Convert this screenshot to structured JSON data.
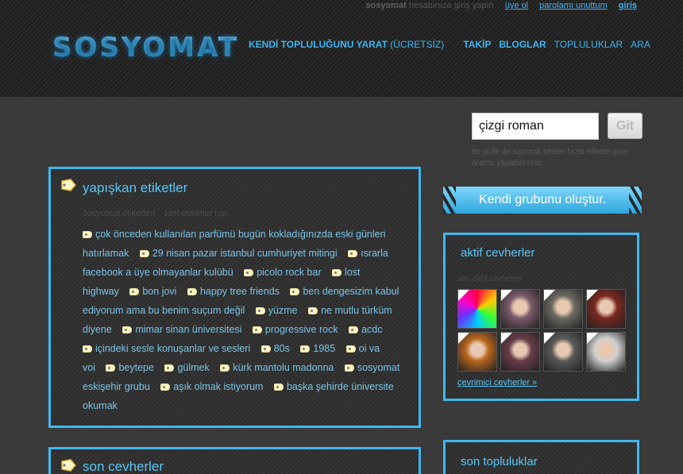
{
  "topbar": {
    "intro_bold": "sosyomat",
    "intro_rest": "hesabınıza giriş yapın",
    "signup": "üye ol",
    "forgot": "parolamı unuttum",
    "login": "giriş"
  },
  "logo": "SOSYOMAT",
  "nav": {
    "create_bold": "KENDİ TOPLULUĞUNU YARAT",
    "create_rest": "(ÜCRETSİZ)",
    "items": [
      {
        "label": "TAKİP",
        "bold": true
      },
      {
        "label": "BLOGLAR",
        "bold": true
      },
      {
        "label": "TOPLULUKLAR",
        "bold": false
      },
      {
        "label": "ARA",
        "bold": false
      }
    ]
  },
  "search": {
    "value": "çizgi roman",
    "button": "Git",
    "hint": "bir gülle de aşırmak birden fazla etikete göre arama yapabilirsiniz."
  },
  "sticky_tags": {
    "title": "yapışkan etiketler",
    "subtitle_left": "sosyomat etiketleri",
    "subtitle_right": "tüm etiketler için",
    "tags": [
      "çok önceden kullanılan parfümü bugün kokladığınızda eski günleri hatırlamak",
      "29 nisan pazar istanbul cumhuriyet mitingi",
      "ısrarla facebook a üye olmayanlar kulübü",
      "picolo rock bar",
      "lost highway",
      "bon jovi",
      "happy tree friends",
      "ben dengesizim kabul ediyorum ama bu benim suçum değil",
      "yüzme",
      "ne mutlu türküm diyene",
      "mimar sinan üniversitesi",
      "progressive rock",
      "acdc",
      "içindeki sesle konuşanlar ve sesleri",
      "80s",
      "1985",
      "oi va voi",
      "beytepe",
      "gülmek",
      "kürk mantolu madonna",
      "sosyomat eskişehir grubu",
      "aşık olmak istiyorum",
      "başka şehirde üniversite okumak"
    ]
  },
  "latest": {
    "title": "son cevherler"
  },
  "banner": "Kendi grubunu oluştur.",
  "active": {
    "title": "aktif cevherler",
    "faint": "son aktif cevherler",
    "link": "çevrimiçi cevherler »",
    "photos": [
      "#c9509c",
      "#7a5a6a",
      "#6d6a62",
      "#7a2820",
      "#b8661e",
      "#6a3c4a",
      "#5a5a5a",
      "#d0d0d0"
    ]
  },
  "communities": {
    "title": "son topluluklar"
  }
}
